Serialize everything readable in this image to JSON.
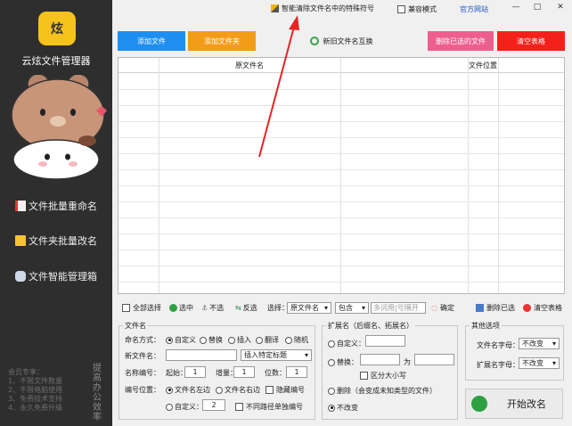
{
  "sidebar": {
    "title": "云炫文件管理器",
    "logo_text": "炫",
    "items": [
      {
        "label": "文件批量重命名"
      },
      {
        "label": "文件夹批量改名"
      },
      {
        "label": "文件智能管理箱"
      }
    ],
    "promo": [
      "会员专享：",
      "1、不限文件数量",
      "2、不限电脑使用",
      "3、免费技术支持",
      "4、永久免费升级"
    ],
    "vertical": "提高办公效率"
  },
  "topbar": {
    "tip": "智能清除文件名中的特殊符号",
    "compat_mode": "兼容模式",
    "website": "官方网站",
    "win_min": "—",
    "win_max": "□",
    "win_close": "✕"
  },
  "actions": {
    "add_file": "添加文件",
    "add_folder": "添加文件夹",
    "swap_names": "新旧文件名互换",
    "delete_selected": "删除已选的文件",
    "clear_table": "清空表格"
  },
  "colors": {
    "blue": "#1e8ff0",
    "orange": "#f39c1a",
    "pink": "#ee5e8e",
    "red": "#f4201a",
    "sidebar": "#2e2e2e"
  },
  "table": {
    "headers": [
      "原文件名",
      "文件位置"
    ]
  },
  "toolbar2": {
    "select_all": "全部选择",
    "select": "选中",
    "deselect": "不选",
    "invert": "反选",
    "choose_label": "选择：",
    "field": "原文件名",
    "op": "包含",
    "filter_placeholder": "多词用|号隔开",
    "confirm": "确定",
    "delete_selected": "删除已选",
    "clear_table": "清空表格"
  },
  "filename": {
    "title": "文件名",
    "mode_label": "命名方式：",
    "modes": [
      "自定义",
      "替换",
      "插入",
      "翻译",
      "随机"
    ],
    "newname_label": "新文件名：",
    "insert_tag": "插入特定标题",
    "numbering_label": "名称编号：",
    "start_label": "起始：",
    "start": "1",
    "inc_label": "增量：",
    "inc": "1",
    "digits_label": "位数：",
    "digits": "1",
    "pos_label": "编号位置：",
    "pos_opts": [
      "文件名左边",
      "文件名右边"
    ],
    "hide_number": "隐藏编号",
    "custom": "自定义：",
    "custom_value": "2",
    "separate_path": "不同路径单独编号"
  },
  "ext": {
    "title": "扩展名（后缀名、拓展名）",
    "custom": "自定义：",
    "replace": "替换：",
    "replace_to": "为",
    "case": "区分大小写",
    "remove": "删除（会变成未知类型的文件）",
    "keep": "不改变"
  },
  "other": {
    "title": "其他选项",
    "name_case_label": "文件名字母：",
    "name_case": "不改变",
    "ext_case_label": "扩展名字母：",
    "ext_case": "不改变"
  },
  "start": {
    "label": "开始改名"
  }
}
